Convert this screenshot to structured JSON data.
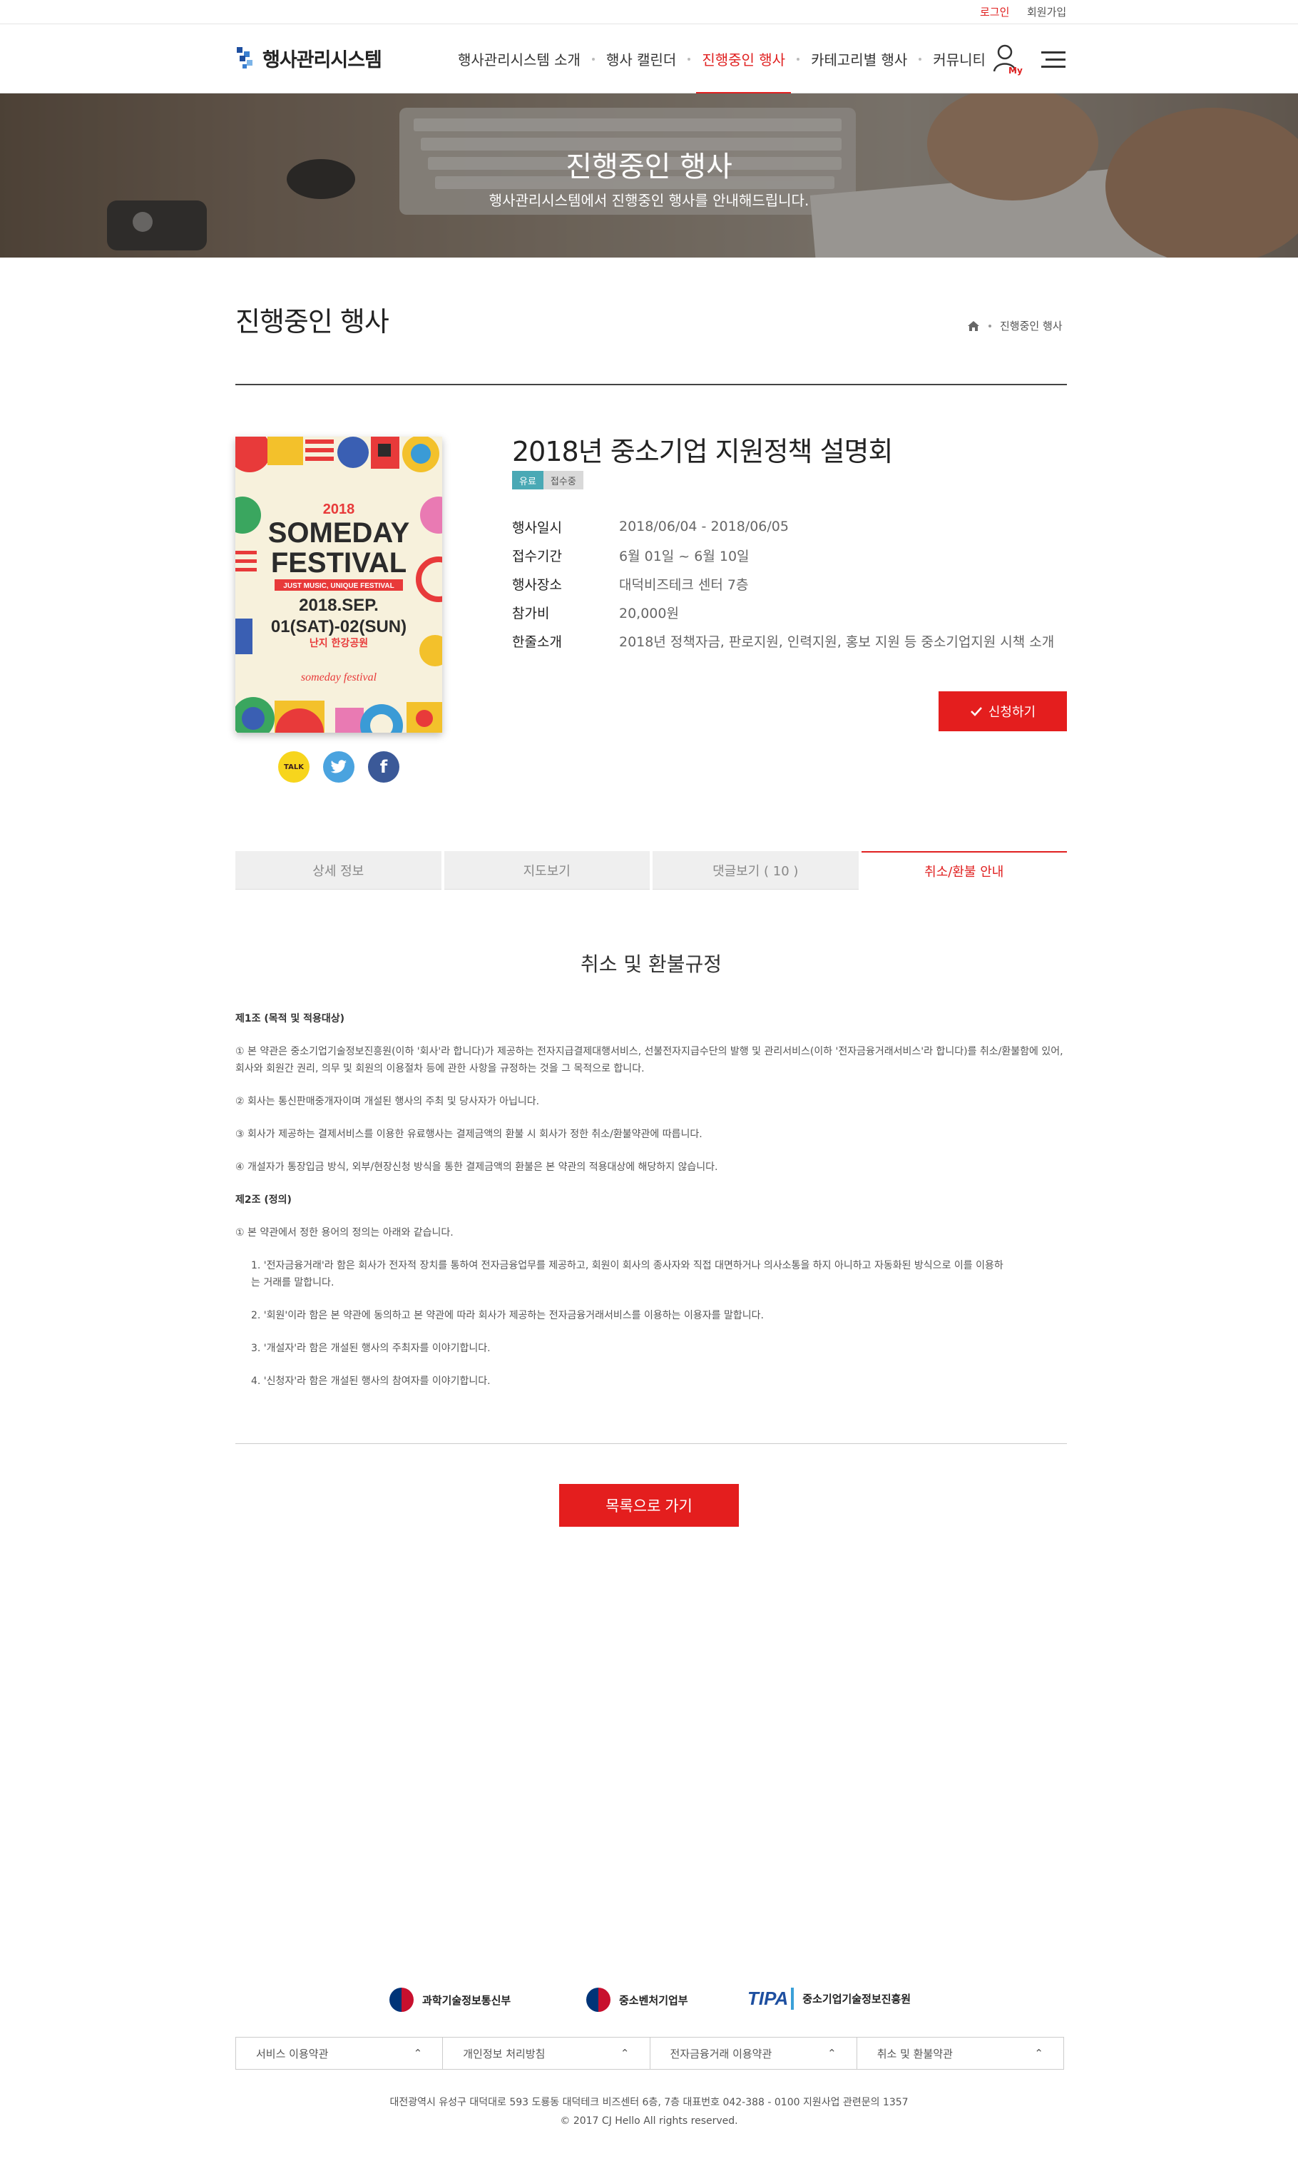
{
  "util": {
    "login": "로그인",
    "signup": "회원가입"
  },
  "header": {
    "logo": "행사관리시스템",
    "nav": [
      "행사관리시스템 소개",
      "행사 캘린더",
      "진행중인 행사",
      "카테고리별 행사",
      "커뮤니티"
    ],
    "active_index": 2,
    "my_label": "My"
  },
  "hero": {
    "title": "진행중인 행사",
    "subtitle": "행사관리시스템에서 진행중인 행사를 안내해드립니다."
  },
  "page": {
    "title": "진행중인 행사",
    "breadcrumb": "진행중인 행사"
  },
  "poster": {
    "year": "2018",
    "line1": "SOMEDAY",
    "line2": "FESTIVAL",
    "tagline": "JUST MUSIC, UNIQUE FESTIVAL",
    "date1": "2018.SEP.",
    "date2": "01(SAT)-02(SUN)",
    "place": "난지 한강공원",
    "brand": "someday festival"
  },
  "share": {
    "kakao": "TALK",
    "twitter": "twitter",
    "facebook": "f"
  },
  "event": {
    "title": "2018년 중소기업 지원정책 설명회",
    "badge_paid": "유료",
    "badge_status": "접수중",
    "rows": [
      {
        "k": "행사일시",
        "v": "2018/06/04 - 2018/06/05"
      },
      {
        "k": "접수기간",
        "v": "6월 01일 ~ 6월 10일"
      },
      {
        "k": "행사장소",
        "v": "대덕비즈테크 센터 7층"
      },
      {
        "k": "참가비",
        "v": "20,000원"
      },
      {
        "k": "한줄소개",
        "v": "2018년 정책자금, 판로지원, 인력지원, 홍보 지원 등 중소기업지원 시책 소개"
      }
    ],
    "apply_label": "신청하기"
  },
  "tabs": [
    "상세 정보",
    "지도보기",
    "댓글보기 ( 10 )",
    "취소/환불 안내"
  ],
  "active_tab": 3,
  "content": {
    "title": "취소 및 환불규정",
    "art1_title": "제1조 (목적 및 적용대상)",
    "art1_p1": "① 본 약관은 중소기업기술정보진흥원(이하 '회사'라 합니다)가 제공하는 전자지급결제대행서비스, 선불전자지급수단의 발행 및 관리서비스(이하 '전자금융거래서비스'라 합니다)를 취소/환불함에 있어, 회사와 회원간 권리, 의무 및 회원의 이용절차 등에 관한 사항을 규정하는 것을 그 목적으로 합니다.",
    "art1_p2": "② 회사는 통신판매중개자이며 개설된 행사의 주최 및 당사자가 아닙니다.",
    "art1_p3": "③ 회사가 제공하는 결제서비스를 이용한 유료행사는 결제금액의 환불 시 회사가 정한 취소/환불약관에 따릅니다.",
    "art1_p4": "④ 개설자가 통장입금 방식, 외부/현장신청 방식을 통한 결제금액의 환불은 본 약관의 적용대상에 해당하지 않습니다.",
    "art2_title": "제2조 (정의)",
    "art2_p1": "①  본 약관에서 정한 용어의 정의는 아래와 같습니다.",
    "art2_i1": "1. '전자금융거래'라 함은 회사가 전자적 장치를 통하여 전자금융업무를 제공하고, 회원이 회사의 종사자와 직접 대면하거나 의사소통을 하지 아니하고 자동화된 방식으로 이를 이용하는 거래를 말합니다.",
    "art2_i2": "2. '회원'이라 함은 본 약관에 동의하고 본 약관에 따라 회사가 제공하는 전자금융거래서비스를 이용하는 이용자를 말합니다.",
    "art2_i3": "3. '개설자'라 함은 개설된 행사의 주최자를 이야기합니다.",
    "art2_i4": "4. '신청자'라 함은 개설된 행사의 참여자를 이야기합니다.",
    "list_button": "목록으로 가기"
  },
  "footer": {
    "partners": [
      "과학기술정보통신부",
      "중소벤처기업부",
      "중소기업기술정보진흥원"
    ],
    "tipa_mark": "TIPA",
    "links": [
      "서비스 이용약관",
      "개인정보 처리방침",
      "전자금융거래 이용약관",
      "취소 및 환불약관"
    ],
    "address": "대전광역시 유성구 대덕대로 593 도룡동 대덕테크 비즈센터 6층, 7층  대표번호 042-388 - 0100  지원사업 관련문의 1357",
    "copyright": "© 2017 CJ Hello All rights reserved."
  },
  "colors": {
    "accent": "#e41e1e",
    "badge_paid": "#4aa9b5",
    "badge_status": "#d9d9d9"
  }
}
